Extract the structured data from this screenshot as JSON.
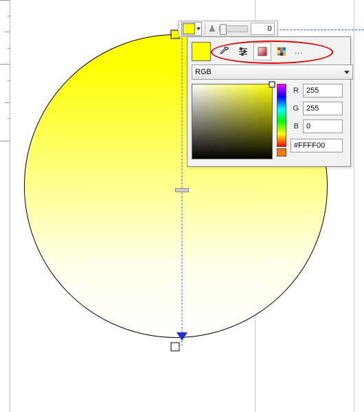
{
  "toolbar": {
    "swatch_color": "#FFFF00",
    "opacity_value": "0"
  },
  "panel": {
    "swatch_color": "#FFFF00",
    "mode": "RGB",
    "r_label": "R",
    "g_label": "G",
    "b_label": "B",
    "r_value": "255",
    "g_value": "255",
    "b_value": "0",
    "hex_value": "#FFFF00",
    "tools": {
      "eyedropper": "eyedropper-icon",
      "sliders": "sliders-icon",
      "gradient": "gradient-icon",
      "palette": "palette-icon",
      "more": "..."
    }
  },
  "gradient": {
    "top_handle_color": "#FFFF00",
    "bottom_handle_color": "#FFFFFF"
  }
}
